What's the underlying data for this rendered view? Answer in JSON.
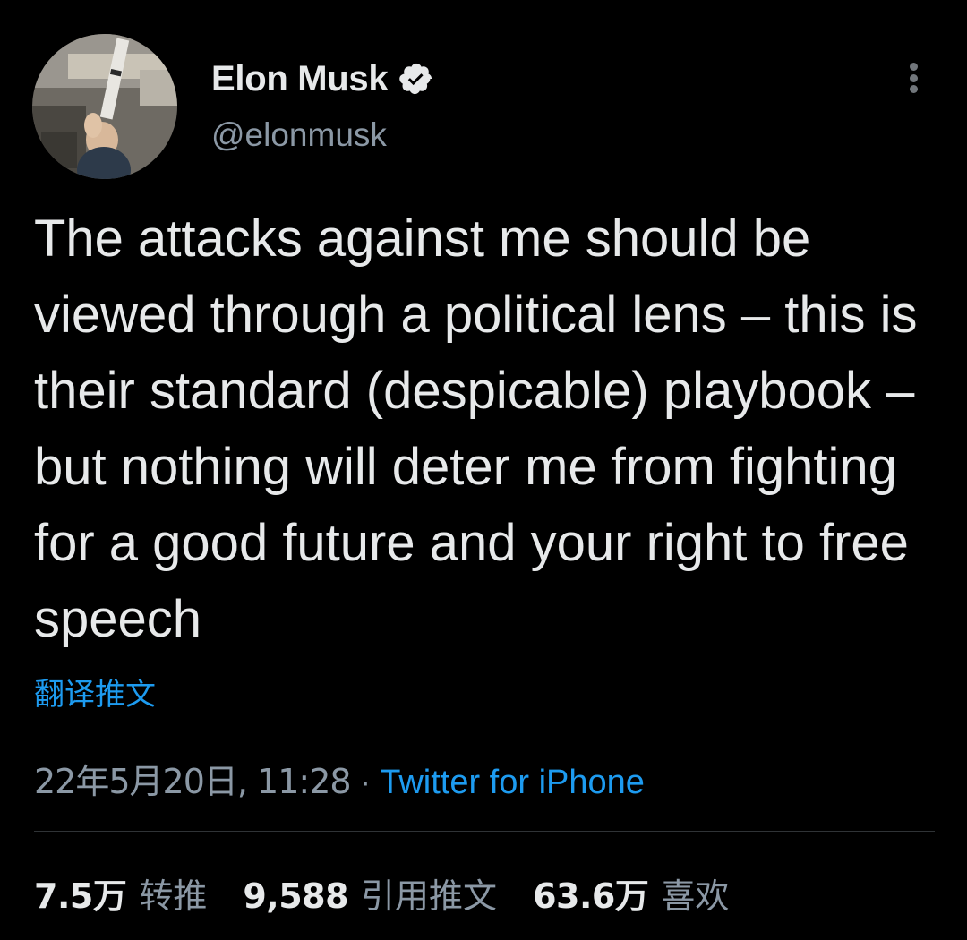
{
  "user": {
    "display_name": "Elon Musk",
    "handle": "@elonmusk",
    "verified_icon": "verified-badge-icon"
  },
  "tweet": {
    "text": "The attacks against me should be viewed through a political lens – this is their standard (despicable) playbook – but nothing will deter me from fighting for a good future and your right to free speech",
    "translate_label": "翻译推文",
    "date": "22年5月20日, 11:28",
    "separator": "·",
    "source": "Twitter for iPhone"
  },
  "stats": {
    "retweets": {
      "value": "7.5万",
      "label": "转推"
    },
    "quotes": {
      "value": "9,588",
      "label": "引用推文"
    },
    "likes": {
      "value": "63.6万",
      "label": "喜欢"
    }
  },
  "colors": {
    "background": "#000000",
    "text": "#e7e9ea",
    "secondary": "#8b98a5",
    "link": "#1d9bf0",
    "divider": "#2f3336"
  }
}
